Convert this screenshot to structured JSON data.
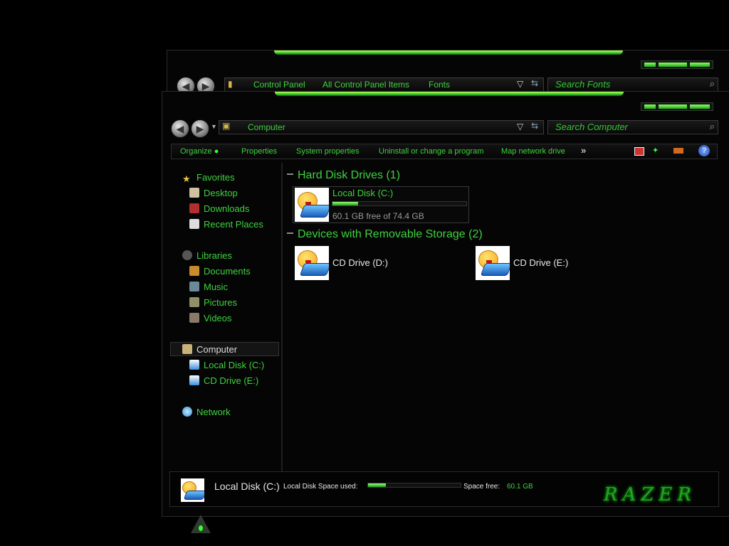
{
  "back_window": {
    "breadcrumb": [
      "Control Panel",
      "All Control Panel Items",
      "Fonts"
    ],
    "search_placeholder": "Search Fonts"
  },
  "main_window": {
    "breadcrumb": "Computer",
    "search_placeholder": "Search Computer"
  },
  "toolbar": {
    "organize": "Organize",
    "properties": "Properties",
    "system_properties": "System properties",
    "uninstall": "Uninstall or change a program",
    "map_drive": "Map network drive",
    "more": "»"
  },
  "sidebar": {
    "favorites": "Favorites",
    "favorites_items": [
      "Desktop",
      "Downloads",
      "Recent Places"
    ],
    "libraries": "Libraries",
    "libraries_items": [
      "Documents",
      "Music",
      "Pictures",
      "Videos"
    ],
    "computer": "Computer",
    "computer_items": [
      "Local Disk (C:)",
      "CD Drive (E:)"
    ],
    "network": "Network"
  },
  "content": {
    "hdd_heading": "Hard Disk Drives (1)",
    "local_disk_name": "Local Disk (C:)",
    "local_disk_free": "60.1 GB free of 74.4 GB",
    "local_disk_used_fraction": 0.19,
    "removable_heading": "Devices with Removable Storage (2)",
    "cd_d": "CD Drive (D:)",
    "cd_e": "CD Drive (E:)"
  },
  "details": {
    "name": "Local Disk (C:)",
    "space_used_label": "Local Disk Space used:",
    "space_free_label": "Space free:",
    "space_free_value": "60.1 GB",
    "used_fraction": 0.19
  },
  "logo_text": "RAZER",
  "colors": {
    "accent": "#3fd23f",
    "background": "#000000"
  }
}
